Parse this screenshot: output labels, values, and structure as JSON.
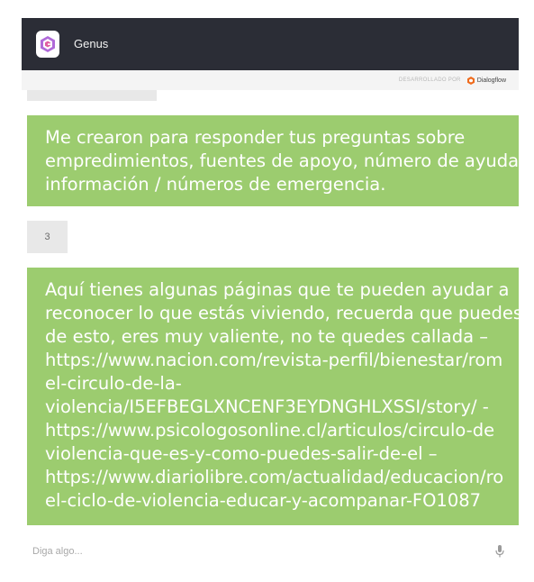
{
  "header": {
    "app_name": "Genus"
  },
  "powered_by": {
    "label": "DESARROLLADO POR",
    "brand": "Dialogflow"
  },
  "messages": [
    {
      "role": "bot",
      "lines": [
        "Me crearon para responder tus preguntas sobre",
        "empredimientos, fuentes de apoyo, número de ayuda",
        "información / números de emergencia."
      ]
    },
    {
      "role": "user",
      "text": "3"
    },
    {
      "role": "bot",
      "lines": [
        "Aquí tienes algunas páginas que te pueden ayudar a",
        "reconocer lo que estás viviendo, recuerda que puedes",
        "de esto, eres muy valiente, no te quedes callada –",
        "https://www.nacion.com/revista-perfil/bienestar/rom",
        "el-circulo-de-la-",
        "violencia/I5EFBEGLXNCENF3EYDNGHLXSSI/story/ -",
        "https://www.psicologosonline.cl/articulos/circulo-de",
        "violencia-que-es-y-como-puedes-salir-de-el –",
        "https://www.diariolibre.com/actualidad/educacion/ro",
        "el-ciclo-de-violencia-educar-y-acompanar-FO1087"
      ]
    }
  ],
  "input": {
    "placeholder": "Diga algo..."
  },
  "colors": {
    "header_bg": "#2b2d36",
    "bot_bubble": "#9ccc6f",
    "user_bubble": "#e8e8e8",
    "logo_purple": "#a55bd6",
    "dialogflow_orange": "#ef6c1e"
  }
}
